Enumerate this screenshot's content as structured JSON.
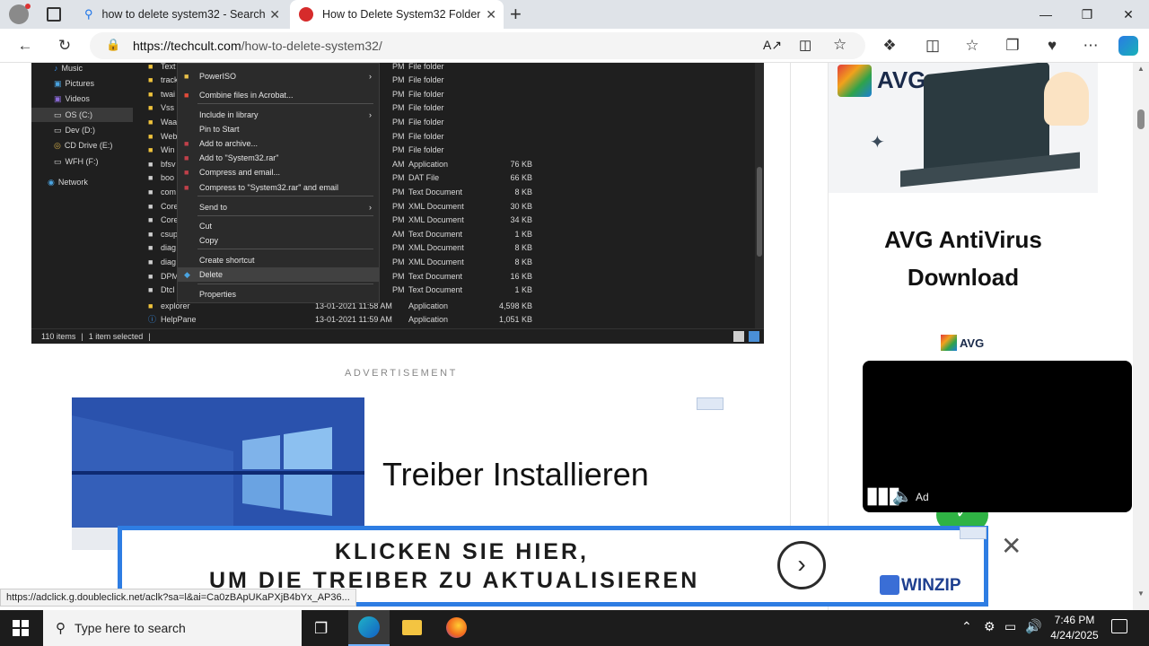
{
  "browser": {
    "tabs": [
      {
        "title": "how to delete system32 - Search"
      },
      {
        "title": "How to Delete System32 Folder in"
      }
    ],
    "new_tab_symbol": "+",
    "url_host": "https://techcult.com",
    "url_path": "/how-to-delete-system32/"
  },
  "explorer": {
    "nav_items": [
      "Music",
      "Pictures",
      "Videos",
      "OS (C:)",
      "Dev (D:)",
      "CD Drive (E:)",
      "WFH (F:)",
      "Network"
    ],
    "partial_names": [
      "Text",
      "track",
      "twai",
      "Vss",
      "Waa",
      "Web",
      "Win",
      "bfsv",
      "boo",
      "com",
      "Core",
      "Core",
      "csup",
      "diag",
      "diag",
      "DPM",
      "Dtcl"
    ],
    "files": [
      {
        "time": "PM",
        "type": "File folder",
        "size": ""
      },
      {
        "time": "PM",
        "type": "File folder",
        "size": ""
      },
      {
        "time": "PM",
        "type": "File folder",
        "size": ""
      },
      {
        "time": "PM",
        "type": "File folder",
        "size": ""
      },
      {
        "time": "PM",
        "type": "File folder",
        "size": ""
      },
      {
        "time": "PM",
        "type": "File folder",
        "size": ""
      },
      {
        "time": "PM",
        "type": "File folder",
        "size": ""
      },
      {
        "time": "AM",
        "type": "Application",
        "size": "76 KB"
      },
      {
        "time": "PM",
        "type": "DAT File",
        "size": "66 KB"
      },
      {
        "time": "PM",
        "type": "Text Document",
        "size": "8 KB"
      },
      {
        "time": "PM",
        "type": "XML Document",
        "size": "30 KB"
      },
      {
        "time": "PM",
        "type": "XML Document",
        "size": "34 KB"
      },
      {
        "time": "AM",
        "type": "Text Document",
        "size": "1 KB"
      },
      {
        "time": "PM",
        "type": "XML Document",
        "size": "8 KB"
      },
      {
        "time": "PM",
        "type": "XML Document",
        "size": "8 KB"
      },
      {
        "time": "PM",
        "type": "Text Document",
        "size": "16 KB"
      },
      {
        "time": "PM",
        "type": "Text Document",
        "size": "1 KB"
      }
    ],
    "full_files": [
      {
        "name": "explorer",
        "date": "13-01-2021 11:58 AM",
        "type": "Application",
        "size": "4,598 KB"
      },
      {
        "name": "HelpPane",
        "date": "13-01-2021 11:59 AM",
        "type": "Application",
        "size": "1,051 KB"
      }
    ],
    "context_menu": [
      "PowerISO",
      "Combine files in Acrobat...",
      "Include in library",
      "Pin to Start",
      "Add to archive...",
      "Add to \"System32.rar\"",
      "Compress and email...",
      "Compress to \"System32.rar\" and email",
      "Send to",
      "Cut",
      "Copy",
      "Create shortcut",
      "Delete",
      "Properties"
    ],
    "status_items": "110 items",
    "status_selected": "1 item selected"
  },
  "content": {
    "ad_label": "ADVERTISEMENT",
    "ad_title": "Treiber Installieren",
    "sidebar_ad_title": "AVG AntiVirus Download",
    "avg_logo": "AVG",
    "video_ad_label": "Ad",
    "banner_line1": "KLICKEN SIE HIER,",
    "banner_line2": "UM DIE TREIBER ZU AKTUALISIEREN",
    "banner_brand": "WINZIP",
    "status_link": "https://adclick.g.doubleclick.net/aclk?sa=l&ai=Ca0zBApUKaPXjB4bYx_AP36..."
  },
  "taskbar": {
    "search_placeholder": "Type here to search",
    "time": "7:46 PM",
    "date": "4/24/2025"
  },
  "colors": {
    "accent_blue": "#2e7de3",
    "explorer_bg": "#1f1f1f",
    "taskbar_bg": "#1c1c1c"
  }
}
